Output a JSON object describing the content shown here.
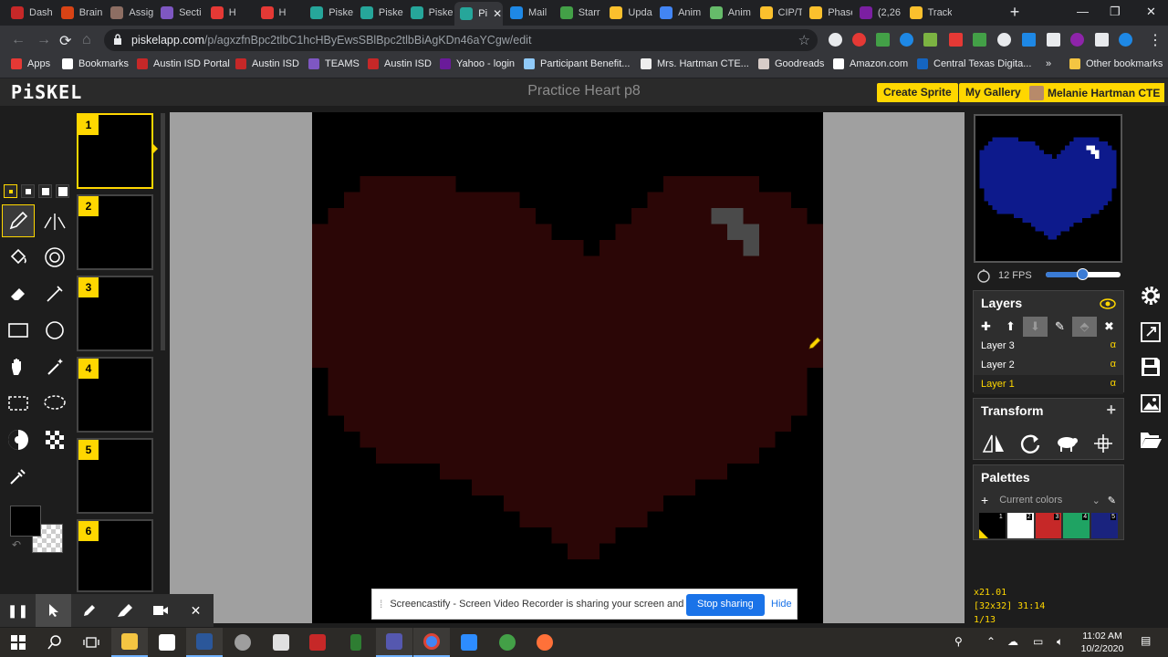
{
  "browser": {
    "tabs": [
      {
        "label": "Dash",
        "color": "#c62828"
      },
      {
        "label": "Brain",
        "color": "#d84315"
      },
      {
        "label": "Assig",
        "color": "#8d6e63"
      },
      {
        "label": "Secti",
        "color": "#7e57c2"
      },
      {
        "label": "H",
        "color": "#e53935"
      },
      {
        "label": "H",
        "color": "#e53935"
      },
      {
        "label": "Piske",
        "color": "#26a69a"
      },
      {
        "label": "Piske",
        "color": "#26a69a"
      },
      {
        "label": "Piske",
        "color": "#26a69a"
      },
      {
        "label": "Pi",
        "color": "#26a69a"
      },
      {
        "label": "Mail",
        "color": "#1e88e5"
      },
      {
        "label": "Starr",
        "color": "#43a047"
      },
      {
        "label": "Upda",
        "color": "#fbc02d"
      },
      {
        "label": "Anim",
        "color": "#4285f4"
      },
      {
        "label": "Anim",
        "color": "#66bb6a"
      },
      {
        "label": "CIP/T",
        "color": "#fbc02d"
      },
      {
        "label": "Phase",
        "color": "#fbc02d"
      },
      {
        "label": "(2,26",
        "color": "#7b1fa2"
      },
      {
        "label": "Track",
        "color": "#fbc02d"
      }
    ],
    "active_tab_index": 9,
    "close_glyph": "✕",
    "new_tab_glyph": "+",
    "window_controls": [
      "—",
      "❐",
      "✕"
    ],
    "url_host": "piskelapp.com",
    "url_path": "/p/agxzfnBpc2tlbC1hcHByEwsSBlBpc2tlbBiAgKDn46aYCgw/edit",
    "bookmarks": [
      {
        "label": "Apps",
        "color": "#e53935"
      },
      {
        "label": "Bookmarks",
        "color": "#ffffff"
      },
      {
        "label": "Austin ISD Portal",
        "color": "#c62828"
      },
      {
        "label": "Austin ISD",
        "color": "#c62828"
      },
      {
        "label": "TEAMS",
        "color": "#7e57c2"
      },
      {
        "label": "Austin ISD",
        "color": "#c62828"
      },
      {
        "label": "Yahoo - login",
        "color": "#6a1b9a"
      },
      {
        "label": "Participant Benefit...",
        "color": "#90caf9"
      },
      {
        "label": "Mrs. Hartman CTE...",
        "color": "#eeeeee"
      },
      {
        "label": "Goodreads",
        "color": "#d7ccc8"
      },
      {
        "label": "Amazon.com",
        "color": "#ffffff"
      },
      {
        "label": "Central Texas Digita...",
        "color": "#1565c0"
      }
    ],
    "bookmarks_more": "»",
    "other_bookmarks": "Other bookmarks"
  },
  "piskel": {
    "logo": "PiSKEL",
    "title": "Practice Heart p8",
    "create_sprite": "Create Sprite",
    "my_gallery": "My Gallery",
    "user": "Melanie Hartman CTE",
    "frames": [
      "1",
      "2",
      "3",
      "4",
      "5",
      "6"
    ],
    "selected_frame": "1",
    "fps_label": "12 FPS",
    "fps_fraction": 0.5,
    "layers_title": "Layers",
    "layers": [
      {
        "name": "Layer 3",
        "alpha": "α",
        "selected": false
      },
      {
        "name": "Layer 2",
        "alpha": "α",
        "selected": false
      },
      {
        "name": "Layer 1",
        "alpha": "α",
        "selected": true
      }
    ],
    "transform_title": "Transform",
    "palettes_title": "Palettes",
    "palette_name": "Current colors",
    "palette": [
      {
        "num": "1",
        "color": "#000000"
      },
      {
        "num": "2",
        "color": "#ffffff"
      },
      {
        "num": "3",
        "color": "#c62828"
      },
      {
        "num": "4",
        "color": "#1fa363"
      },
      {
        "num": "5",
        "color": "#1a237e"
      }
    ],
    "zoom": "x21.01",
    "cursor": "[32x32] 31:14",
    "frame_counter": "1/13",
    "colors": {
      "accent": "#ffd700",
      "heart_canvas": "#2b0606",
      "heart_preview": "#0d1a8c",
      "highlight_canvas": "#4a4a4a",
      "highlight_preview": "#ffffff"
    }
  },
  "screencastify": {
    "message": "Screencastify - Screen Video Recorder is sharing your screen and audio.",
    "stop": "Stop sharing",
    "hide": "Hide"
  },
  "taskbar": {
    "time": "11:02 AM",
    "date": "10/2/2020"
  }
}
